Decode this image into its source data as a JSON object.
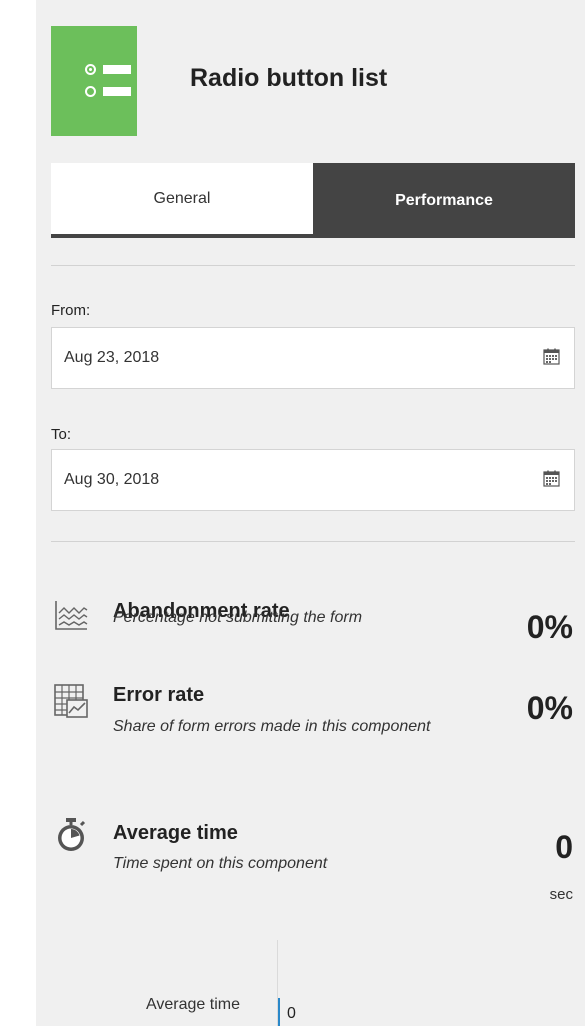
{
  "header": {
    "title": "Radio button list",
    "icon": "radio-list-icon",
    "icon_color": "#6cbf5b"
  },
  "tabs": [
    {
      "label": "General",
      "active": false
    },
    {
      "label": "Performance",
      "active": true
    }
  ],
  "date_range": {
    "from_label": "From:",
    "from_value": "Aug 23, 2018",
    "to_label": "To:",
    "to_value": "Aug 30, 2018"
  },
  "metrics": [
    {
      "title": "Abandonment rate",
      "description": "Percentage not submitting the form",
      "value": "0%",
      "icon": "line-chart-icon"
    },
    {
      "title": "Error rate",
      "description": "Share of form errors made in this component",
      "value": "0%",
      "icon": "table-chart-icon"
    },
    {
      "title": "Average time",
      "description": "Time spent on this component",
      "value": "0",
      "unit": "sec",
      "icon": "stopwatch-icon"
    }
  ],
  "mini_chart": {
    "label": "Average time",
    "value": "0"
  }
}
